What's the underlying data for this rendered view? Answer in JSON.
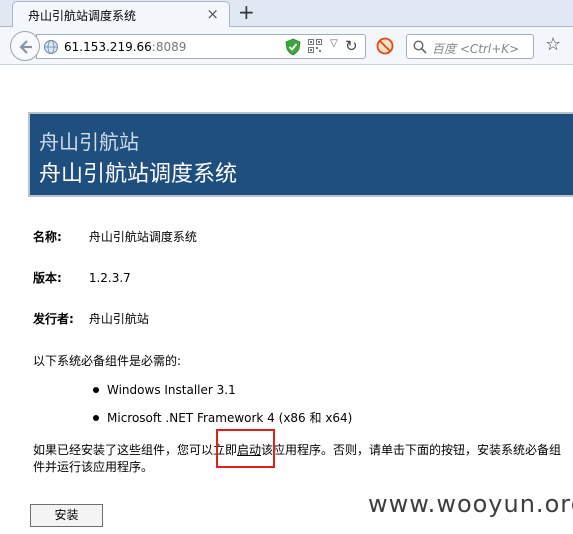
{
  "browser": {
    "tab_title": "舟山引航站调度系统",
    "tab_close": "×",
    "new_tab": "+",
    "url_host": "61.153.219.66",
    "url_port": ":8089",
    "search_placeholder": "百度 <Ctrl+K>",
    "reload": "↻",
    "dropdown": "▽",
    "star": "☆"
  },
  "banner": {
    "subtitle": "舟山引航站",
    "title": "舟山引航站调度系统",
    "background_color": "#1f4f7f"
  },
  "info": {
    "name_label": "名称:",
    "name_value": "舟山引航站调度系统",
    "version_label": "版本:",
    "version_value": "1.2.3.7",
    "publisher_label": "发行者:",
    "publisher_value": "舟山引航站"
  },
  "prereq": {
    "heading": "以下系统必备组件是必需的:",
    "items": [
      "Windows Installer 3.1",
      "Microsoft .NET Framework 4 (x86 和 x64)"
    ]
  },
  "instructions": {
    "text": "如果已经安装了这些组件，您可以立即启动该应用程序。否则，请单击下面的按钮，安装系统必备组件并运行该应用程序。",
    "link_text": "启动",
    "before_link": "如果已经安装了这些组件，您可以立即",
    "after_link": "该应用程序。否则，请单击下面的按钮，安装系统必备组件并运行该应用程序。",
    "highlight_color": "#e01f1f"
  },
  "install_button": "安装",
  "watermark": "www.wooyun.org"
}
